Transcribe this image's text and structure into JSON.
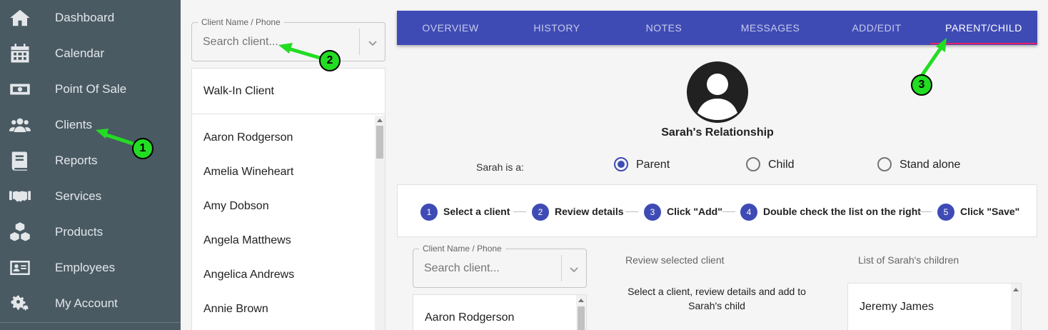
{
  "sidebar": {
    "items": [
      {
        "label": "Dashboard",
        "icon": "home-icon"
      },
      {
        "label": "Calendar",
        "icon": "calendar-icon"
      },
      {
        "label": "Point Of Sale",
        "icon": "cash-icon"
      },
      {
        "label": "Clients",
        "icon": "users-icon"
      },
      {
        "label": "Reports",
        "icon": "book-icon"
      },
      {
        "label": "Services",
        "icon": "handshake-icon"
      },
      {
        "label": "Products",
        "icon": "boxes-icon"
      },
      {
        "label": "Employees",
        "icon": "id-card-icon"
      },
      {
        "label": "My Account",
        "icon": "gears-icon"
      }
    ]
  },
  "client_panel": {
    "search": {
      "legend": "Client Name / Phone",
      "placeholder": "Search client..."
    },
    "walk_in": "Walk-In Client",
    "clients": [
      "Aaron Rodgerson",
      "Amelia Wineheart",
      "Amy Dobson",
      "Angela Matthews",
      "Angelica Andrews",
      "Annie Brown"
    ]
  },
  "tabs": [
    {
      "label": "OVERVIEW"
    },
    {
      "label": "HISTORY"
    },
    {
      "label": "NOTES"
    },
    {
      "label": "MESSAGES"
    },
    {
      "label": "ADD/EDIT"
    },
    {
      "label": "PARENT/CHILD",
      "active": true
    }
  ],
  "relationship": {
    "title": "Sarah's Relationship",
    "prompt": "Sarah is a:",
    "options": [
      {
        "label": "Parent",
        "checked": true
      },
      {
        "label": "Child",
        "checked": false
      },
      {
        "label": "Stand alone",
        "checked": false
      }
    ]
  },
  "steps": [
    {
      "num": "1",
      "label": "Select a client"
    },
    {
      "num": "2",
      "label": "Review details"
    },
    {
      "num": "3",
      "label": "Click \"Add\""
    },
    {
      "num": "4",
      "label": "Double check the list on the right"
    },
    {
      "num": "5",
      "label": "Click \"Save\""
    }
  ],
  "lower": {
    "search": {
      "legend": "Client Name / Phone",
      "placeholder": "Search client..."
    },
    "clients": [
      "Aaron Rodgerson"
    ],
    "review_heading": "Review selected client",
    "review_text": "Select a client, review details and add to Sarah's child",
    "children_heading": "List of Sarah's children",
    "children": [
      "Jeremy James"
    ]
  },
  "annotations": [
    "1",
    "2",
    "3"
  ],
  "colors": {
    "sidebar": "#4a5a63",
    "tab_bar": "#3f4bb5",
    "indicator": "#e91e63",
    "badge": "#22dd22"
  }
}
